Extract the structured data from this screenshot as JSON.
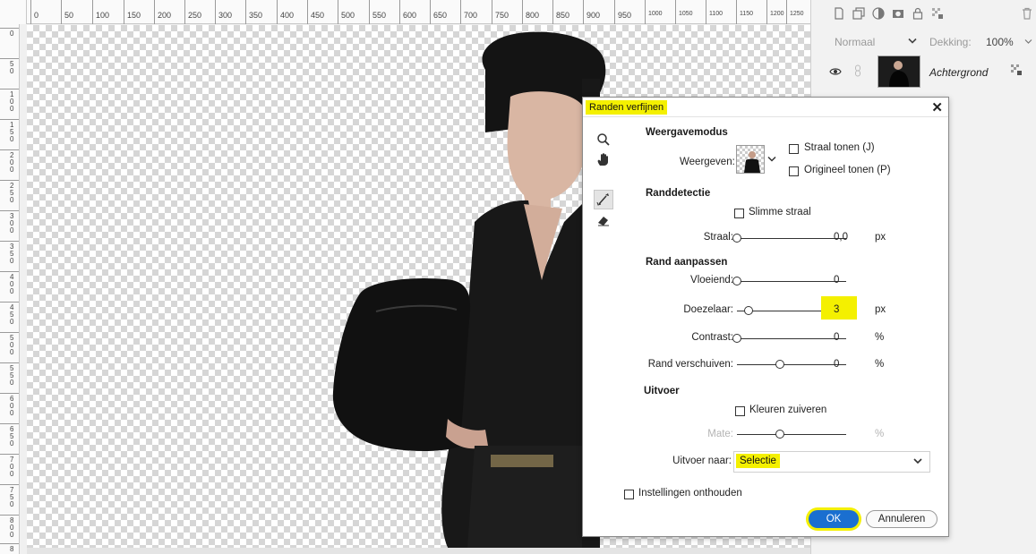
{
  "ruler": {
    "top_labels": [
      "0",
      "50",
      "100",
      "150",
      "200",
      "250",
      "300",
      "350",
      "400",
      "450",
      "500",
      "550",
      "600",
      "650",
      "700",
      "750",
      "800",
      "850",
      "900",
      "950",
      "1000",
      "1050",
      "1100",
      "1150",
      "1200",
      "1250"
    ],
    "left_labels": [
      "0",
      "5\n0",
      "1\n0\n0",
      "1\n5\n0",
      "2\n0\n0",
      "2\n5\n0",
      "3\n0\n0",
      "3\n5\n0",
      "4\n0\n0",
      "4\n5\n0",
      "5\n0\n0",
      "5\n5\n0",
      "6\n0\n0",
      "6\n5\n0",
      "7\n0\n0",
      "7\n5\n0",
      "8\n0\n0",
      "8"
    ]
  },
  "layers": {
    "blend_mode": "Normaal",
    "opacity_label": "Dekking:",
    "opacity_value": "100%",
    "layer_name": "Achtergrond",
    "toolbar_icons": [
      "new-layer-icon",
      "duplicate-icon",
      "adjustment-icon",
      "mask-icon",
      "lock-icon",
      "transparency-lock-icon",
      "trash-icon"
    ]
  },
  "dialog": {
    "title": "Randen verfijnen",
    "tools": [
      "zoom-icon",
      "hand-icon",
      "refine-radius-brush-icon",
      "eraser-icon"
    ],
    "view_mode": {
      "heading": "Weergavemodus",
      "view_label": "Weergeven:",
      "show_radius": "Straal tonen (J)",
      "show_original": "Origineel tonen (P)"
    },
    "edge_detection": {
      "heading": "Randdetectie",
      "smart_radius": "Slimme straal",
      "radius_label": "Straal:",
      "radius_value": "0,0",
      "radius_unit": "px",
      "radius_level": 0
    },
    "adjust_edge": {
      "heading": "Rand aanpassen",
      "smooth_label": "Vloeiend:",
      "smooth_value": "0",
      "smooth_level": 0,
      "feather_label": "Doezelaar:",
      "feather_value": "3",
      "feather_unit": "px",
      "feather_level": 0.05,
      "contrast_label": "Contrast:",
      "contrast_value": "0",
      "contrast_unit": "%",
      "contrast_level": 0,
      "shift_label": "Rand verschuiven:",
      "shift_value": "0",
      "shift_unit": "%",
      "shift_level": 0.5
    },
    "output": {
      "heading": "Uitvoer",
      "decontaminate": "Kleuren zuiveren",
      "amount_label": "Mate:",
      "amount_unit": "%",
      "amount_level": 0.5,
      "output_to_label": "Uitvoer naar:",
      "output_to_value": "Selectie"
    },
    "remember_settings": "Instellingen onthouden",
    "ok_label": "OK",
    "cancel_label": "Annuleren"
  },
  "colors": {
    "highlight": "#f4f000",
    "ok_button": "#1a6fd0",
    "photo_dark": "#1a1a1a"
  }
}
